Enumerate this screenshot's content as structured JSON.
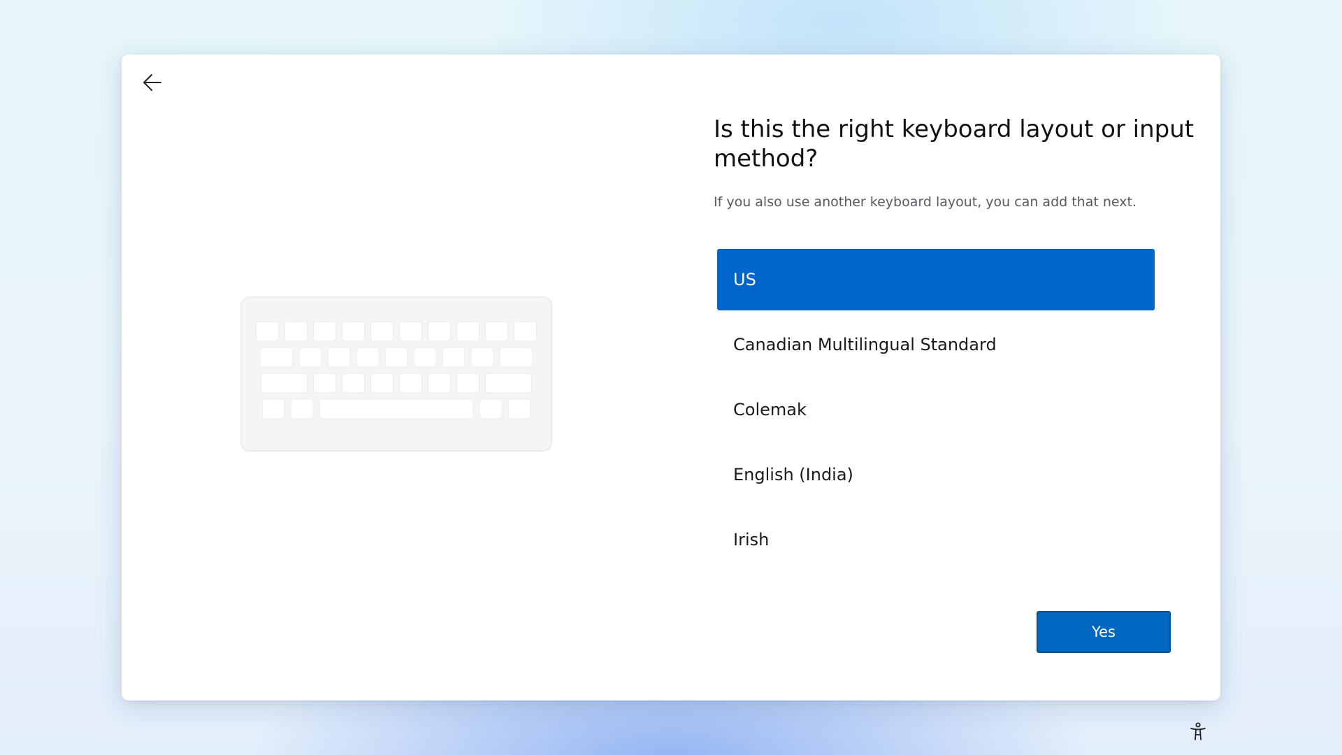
{
  "dialog": {
    "title": "Is this the right keyboard layout or input method?",
    "subtitle": "If you also use another keyboard layout, you can add that next.",
    "back_icon": "arrow-left-icon",
    "illustration_icon": "keyboard-icon",
    "layouts": [
      {
        "label": "US",
        "selected": true
      },
      {
        "label": "Canadian Multilingual Standard",
        "selected": false
      },
      {
        "label": "Colemak",
        "selected": false
      },
      {
        "label": "English (India)",
        "selected": false
      },
      {
        "label": "Irish",
        "selected": false
      }
    ],
    "confirm_label": "Yes"
  },
  "footer": {
    "accessibility_icon": "accessibility-icon"
  },
  "colors": {
    "accent": "#0066cc",
    "button": "#0067c0",
    "text": "#111111",
    "subtext": "#555a60"
  }
}
